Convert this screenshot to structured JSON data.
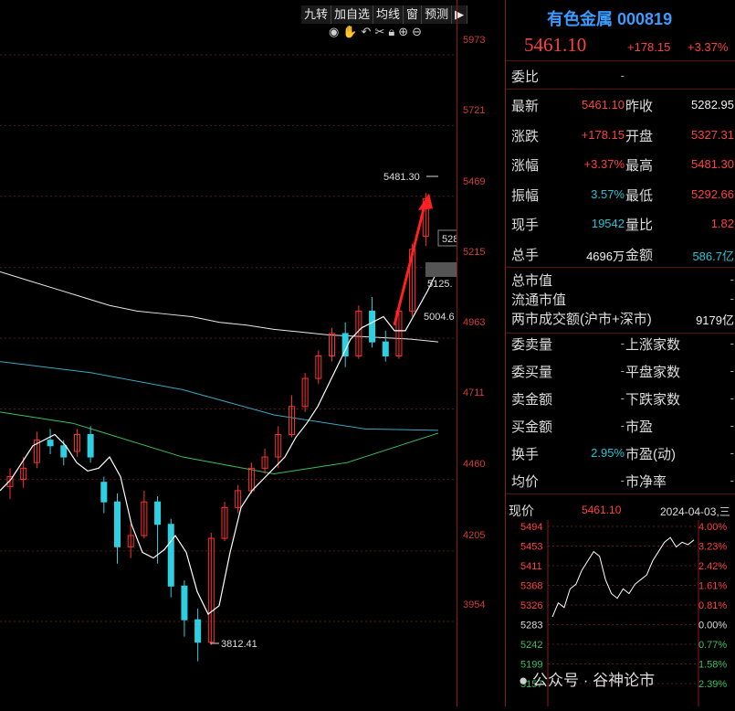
{
  "toolbar": {
    "items": [
      "九转",
      "加自选",
      "均线",
      "窗",
      "预测"
    ],
    "arrow": "▶"
  },
  "icons": [
    "eye-icon",
    "hand-icon",
    "undo-icon",
    "scissors-icon",
    "lock-icon",
    "zoom-in-icon",
    "zoom-out-icon"
  ],
  "price_axis": {
    "ticks": [
      "5973",
      "5721",
      "5469",
      "5215",
      "4963",
      "4711",
      "4460",
      "4205",
      "3954"
    ]
  },
  "annotations": {
    "high": "5481.30",
    "low": "3812.41",
    "ma_a": "528",
    "ma_b": "5125.",
    "ma_c": "5004.6"
  },
  "stock": {
    "name": "有色金属",
    "code": "000819",
    "price": "5461.10",
    "change": "+178.15",
    "pct": "+3.37%"
  },
  "quote": {
    "weibi_label": "委比",
    "weibi_val": "-",
    "rows": [
      {
        "l1": "最新",
        "v1": "5461.10",
        "c1": "red",
        "l2": "昨收",
        "v2": "5282.95",
        "c2": "white"
      },
      {
        "l1": "涨跌",
        "v1": "+178.15",
        "c1": "red",
        "l2": "开盘",
        "v2": "5327.31",
        "c2": "red"
      },
      {
        "l1": "涨幅",
        "v1": "+3.37%",
        "c1": "red",
        "l2": "最高",
        "v2": "5481.30",
        "c2": "red"
      },
      {
        "l1": "振幅",
        "v1": "3.57%",
        "c1": "cyan",
        "l2": "最低",
        "v2": "5292.66",
        "c2": "red"
      },
      {
        "l1": "现手",
        "v1": "19542",
        "c1": "cyan",
        "l2": "量比",
        "v2": "1.82",
        "c2": "red"
      },
      {
        "l1": "总手",
        "v1": "4696万",
        "c1": "white",
        "l2": "金额",
        "v2": "586.7亿",
        "c2": "cyan"
      }
    ],
    "market": [
      {
        "label": "总市值",
        "val": "-"
      },
      {
        "label": "流通市值",
        "val": "-"
      },
      {
        "label": "两市成交额(沪市+深市)",
        "val": "9179亿"
      }
    ],
    "breadth": [
      {
        "l1": "委卖量",
        "v1": "-",
        "l2": "上涨家数",
        "v2": "-"
      },
      {
        "l1": "委买量",
        "v1": "-",
        "l2": "平盘家数",
        "v2": "-"
      },
      {
        "l1": "卖金额",
        "v1": "-",
        "l2": "下跌家数",
        "v2": "-"
      },
      {
        "l1": "买金额",
        "v1": "-",
        "l2": "市盈",
        "v2": "-"
      },
      {
        "l1": "换手",
        "v1": "2.95%",
        "l2": "市盈(动)",
        "v2": "-"
      },
      {
        "l1": "均价",
        "v1": "-",
        "l2": "市净率",
        "v2": "-"
      }
    ]
  },
  "mini": {
    "label": "现价",
    "price": "5461.10",
    "date": "2024-04-03,三",
    "left_ticks": [
      "5494",
      "5453",
      "5411",
      "5368",
      "5326",
      "5283",
      "5242",
      "5199",
      "5157"
    ],
    "right_ticks": [
      "4.00%",
      "3.23%",
      "2.42%",
      "1.61%",
      "0.81%",
      "0.00%",
      "0.77%",
      "1.58%",
      "2.39%"
    ]
  },
  "watermark": "公众号 · 谷神论市",
  "chart_data": {
    "type": "candlestick",
    "ylim": [
      3800,
      6050
    ],
    "ma_white_short": [
      4420,
      4460,
      4520,
      4580,
      4600,
      4620,
      4580,
      4520,
      4490,
      4500,
      4540,
      4470,
      4300,
      4200,
      4180,
      4210,
      4260,
      4200,
      4060,
      3980,
      4010,
      4200,
      4360,
      4420,
      4460,
      4500,
      4540,
      4610,
      4660,
      4720,
      4800,
      4880,
      4960,
      5000,
      5020,
      5040,
      4990,
      4990,
      5060,
      5130,
      5210
    ],
    "ma_white_long": [
      5200,
      5170,
      5140,
      5110,
      5080,
      5060,
      5050,
      5040,
      5020,
      5010,
      4995,
      4985,
      4975,
      4970,
      4965,
      4960,
      4950
    ],
    "candles": [
      [
        4435,
        4470,
        4390,
        4500,
        "r"
      ],
      [
        4460,
        4500,
        4430,
        4540,
        "r"
      ],
      [
        4520,
        4600,
        4500,
        4630,
        "r"
      ],
      [
        4600,
        4580,
        4550,
        4640,
        "c"
      ],
      [
        4580,
        4540,
        4510,
        4600,
        "c"
      ],
      [
        4560,
        4620,
        4540,
        4640,
        "r"
      ],
      [
        4620,
        4540,
        4520,
        4650,
        "c"
      ],
      [
        4450,
        4380,
        4340,
        4470,
        "c"
      ],
      [
        4380,
        4220,
        4160,
        4410,
        "c"
      ],
      [
        4220,
        4260,
        4180,
        4300,
        "r"
      ],
      [
        4260,
        4380,
        4250,
        4420,
        "r"
      ],
      [
        4380,
        4300,
        4160,
        4400,
        "c"
      ],
      [
        4300,
        4080,
        4040,
        4320,
        "c"
      ],
      [
        4080,
        3960,
        3900,
        4100,
        "c"
      ],
      [
        3960,
        3880,
        3812,
        4000,
        "c"
      ],
      [
        3880,
        4250,
        3870,
        4270,
        "r"
      ],
      [
        4250,
        4360,
        4240,
        4380,
        "r"
      ],
      [
        4360,
        4420,
        4340,
        4440,
        "r"
      ],
      [
        4420,
        4500,
        4410,
        4520,
        "r"
      ],
      [
        4500,
        4540,
        4480,
        4570,
        "r"
      ],
      [
        4540,
        4620,
        4500,
        4650,
        "r"
      ],
      [
        4620,
        4720,
        4610,
        4760,
        "r"
      ],
      [
        4720,
        4820,
        4700,
        4840,
        "r"
      ],
      [
        4820,
        4900,
        4800,
        4920,
        "r"
      ],
      [
        4900,
        4980,
        4880,
        5000,
        "r"
      ],
      [
        4980,
        4900,
        4860,
        5020,
        "c"
      ],
      [
        4900,
        5060,
        4890,
        5080,
        "r"
      ],
      [
        5060,
        4950,
        4930,
        5110,
        "c"
      ],
      [
        4950,
        4900,
        4880,
        4990,
        "c"
      ],
      [
        4900,
        5060,
        4890,
        5080,
        "r"
      ],
      [
        5060,
        5280,
        5040,
        5300,
        "r"
      ],
      [
        5327,
        5461,
        5292,
        5481,
        "r"
      ]
    ]
  }
}
